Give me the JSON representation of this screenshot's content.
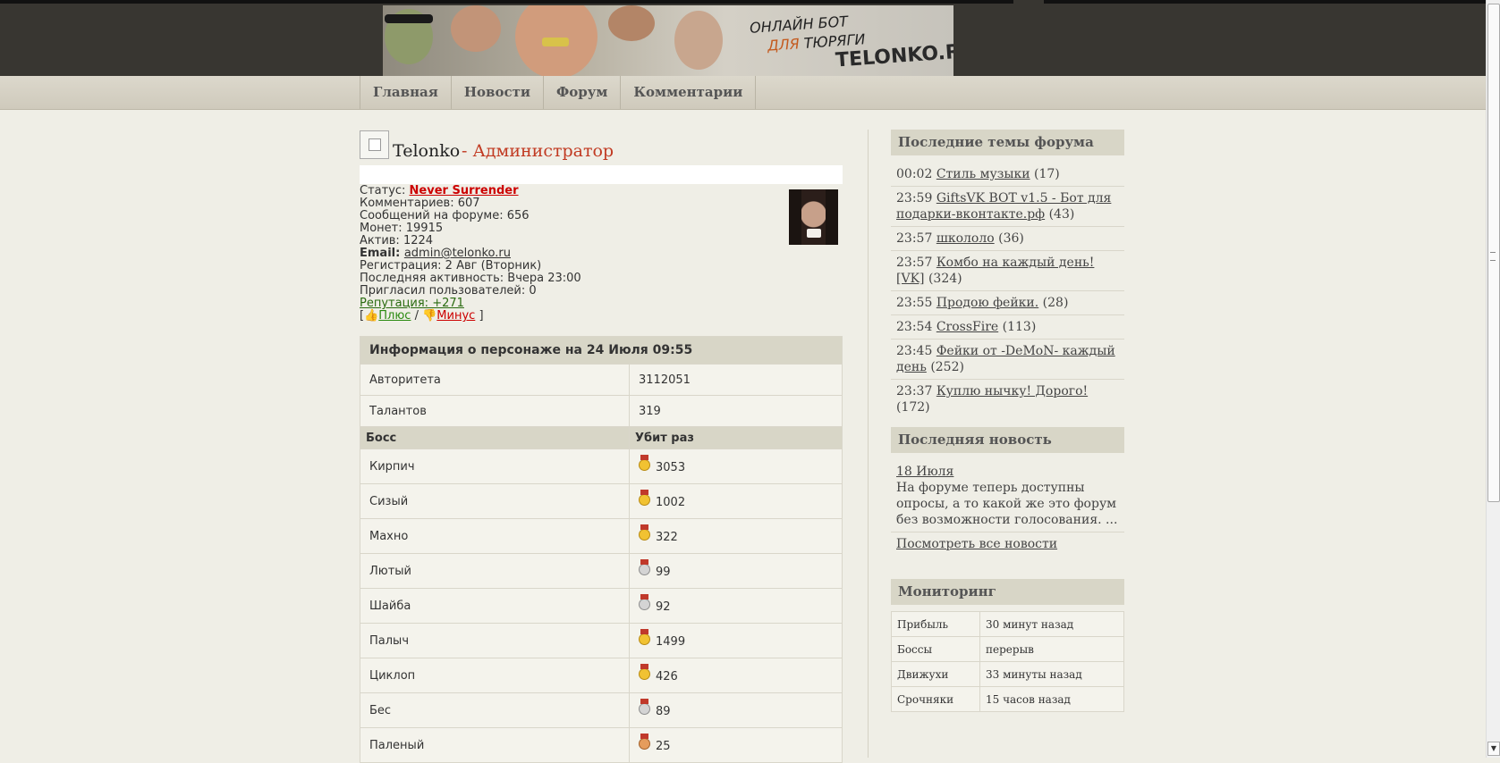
{
  "banner": {
    "line1": "ОНЛАЙН БОТ",
    "line2_prefix": "ДЛЯ",
    "line2_rest": " ТЮРЯГИ",
    "logo": "TELONKO.RU"
  },
  "nav": [
    "Главная",
    "Новости",
    "Форум",
    "Комментарии"
  ],
  "profile": {
    "name": "Telonko",
    "role": "- Администратор",
    "status_label": "Статус: ",
    "status_value": "Never Surrender",
    "lines": [
      "Комментариев: 607",
      "Сообщений на форуме: 656",
      "Монет: 19915",
      "Актив: 1224"
    ],
    "email_label": "Email: ",
    "email_value": "admin@telonko.ru",
    "lines2": [
      "Регистрация: 2 Авг (Вторник)",
      "Последняя активность: Вчера 23:00",
      "Пригласил пользователей: 0"
    ],
    "reputation": "Репутация: +271",
    "vote_open": "[",
    "vote_plus": "Плюс",
    "vote_sep": " / ",
    "vote_minus": "Минус",
    "vote_close": " ]"
  },
  "char_info": {
    "title": "Информация о персонаже на 24 Июля 09:55",
    "rows": [
      {
        "label": "Авторитета",
        "value": "3112051"
      },
      {
        "label": "Талантов",
        "value": "319"
      }
    ],
    "boss_header": {
      "col1": "Босс",
      "col2": "Убит раз"
    },
    "bosses": [
      {
        "name": "Кирпич",
        "count": "3053",
        "medal": "gold"
      },
      {
        "name": "Сизый",
        "count": "1002",
        "medal": "gold"
      },
      {
        "name": "Махно",
        "count": "322",
        "medal": "gold"
      },
      {
        "name": "Лютый",
        "count": "99",
        "medal": "silver"
      },
      {
        "name": "Шайба",
        "count": "92",
        "medal": "silver"
      },
      {
        "name": "Палыч",
        "count": "1499",
        "medal": "gold"
      },
      {
        "name": "Циклоп",
        "count": "426",
        "medal": "gold"
      },
      {
        "name": "Бес",
        "count": "89",
        "medal": "silver"
      },
      {
        "name": "Паленый",
        "count": "25",
        "medal": "bronze"
      }
    ]
  },
  "forum": {
    "title": "Последние темы форума",
    "topics": [
      {
        "time": "00:02",
        "title": "Стиль музыки",
        "count": "(17)"
      },
      {
        "time": "23:59",
        "title": "GiftsVK BOT v1.5 - Бот для подарки-вконтакте.рф",
        "count": "(43)"
      },
      {
        "time": "23:57",
        "title": "школоло",
        "count": "(36)"
      },
      {
        "time": "23:57",
        "title": "Комбо на каждый день! [VK]",
        "count": "(324)"
      },
      {
        "time": "23:55",
        "title": "Продою фейки.",
        "count": "(28)"
      },
      {
        "time": "23:54",
        "title": "CrossFire",
        "count": "(113)"
      },
      {
        "time": "23:45",
        "title": "Фейки от -DeMoN- каждый день",
        "count": "(252)"
      },
      {
        "time": "23:37",
        "title": "Куплю нычку! Дорого!",
        "count": "(172)"
      }
    ]
  },
  "news": {
    "title": "Последняя новость",
    "date": "18 Июля",
    "text": "На форуме теперь доступны опросы, а то какой же это форум без возможности голосования. ...",
    "all_link": "Посмотреть все новости"
  },
  "monitoring": {
    "title": "Мониторинг",
    "rows": [
      {
        "label": "Прибыль",
        "value": "30 минут назад"
      },
      {
        "label": "Боссы",
        "value": "перерыв"
      },
      {
        "label": "Движухи",
        "value": "33 минуты назад"
      },
      {
        "label": "Срочняки",
        "value": "15 часов назад"
      }
    ]
  },
  "colors": {
    "header_bg": "#383631",
    "accent_red": "#c13a22",
    "panel_header": "#d8d6c7"
  }
}
